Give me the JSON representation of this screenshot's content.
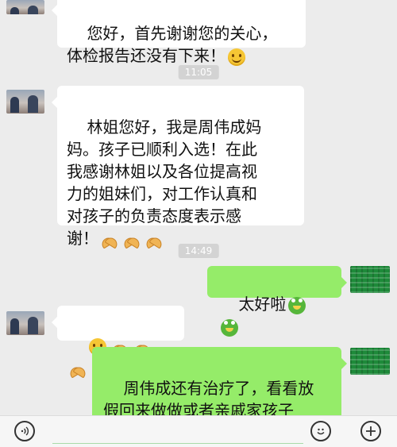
{
  "messages": {
    "m1": {
      "sender": "other",
      "text": "您好，首先谢谢您的关心，\n体检报告还没有下来！"
    },
    "ts1": "11:05",
    "m2": {
      "sender": "other",
      "text": "林姐您好，我是周伟成妈\n妈。孩子已顺利入选！在此\n我感谢林姐以及各位提高视\n力的姐妹们，对工作认真和\n对孩子的负责态度表示感\n谢！"
    },
    "ts2": "14:49",
    "m3": {
      "sender": "me",
      "text": "太好啦"
    },
    "m4": {
      "sender": "other",
      "text": ""
    },
    "m5": {
      "sender": "me",
      "text": "周伟成还有治疗了，看看放\n假回来做做或者亲戚家孩子\n过来保健也行"
    }
  },
  "icons": {
    "voice": "voice-icon",
    "emoji": "emoji-icon",
    "more": "plus-icon",
    "smile": "smile-emoji",
    "pray": "pray-emoji",
    "frog": "frog-emoji"
  },
  "colors": {
    "my_bubble": "#95ec69",
    "their_bubble": "#ffffff",
    "background": "#ececec"
  }
}
